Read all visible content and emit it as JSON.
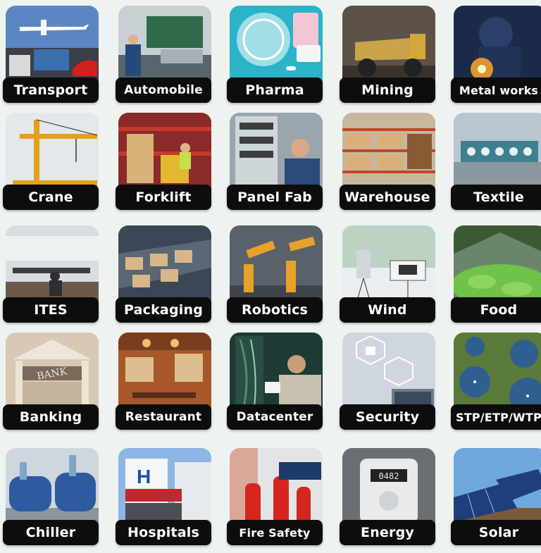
{
  "tiles": [
    {
      "label": "Transport",
      "icon": "airplane-truck-icon",
      "colors": [
        "#5b86c4",
        "#d9e4f2"
      ]
    },
    {
      "label": "Automobile",
      "icon": "car-assembly-icon",
      "colors": [
        "#6f7d86",
        "#c9d0d4"
      ]
    },
    {
      "label": "Pharma",
      "icon": "pills-icon",
      "colors": [
        "#2ab3c9",
        "#e8f6f8"
      ]
    },
    {
      "label": "Mining",
      "icon": "dump-truck-icon",
      "colors": [
        "#5c5248",
        "#c9a44a"
      ]
    },
    {
      "label": "Metal works",
      "icon": "welding-icon",
      "colors": [
        "#1c2a4a",
        "#f0a030"
      ]
    },
    {
      "label": "Crane",
      "icon": "crane-icon",
      "colors": [
        "#e4e8ea",
        "#e1a21a"
      ]
    },
    {
      "label": "Forklift",
      "icon": "forklift-icon",
      "colors": [
        "#8a2a2a",
        "#d9b27a"
      ]
    },
    {
      "label": "Panel Fab",
      "icon": "electric-panel-icon",
      "colors": [
        "#9aa6ae",
        "#2d4a78"
      ]
    },
    {
      "label": "Warehouse",
      "icon": "warehouse-racks-icon",
      "colors": [
        "#c7b79d",
        "#8a5a33"
      ]
    },
    {
      "label": "Textile",
      "icon": "textile-machine-icon",
      "colors": [
        "#b9c6cf",
        "#3f7f8f"
      ]
    },
    {
      "label": "ITES",
      "icon": "office-desk-icon",
      "colors": [
        "#d8dde0",
        "#3a3f45"
      ]
    },
    {
      "label": "Packaging",
      "icon": "conveyor-boxes-icon",
      "colors": [
        "#3b4754",
        "#d7b78a"
      ]
    },
    {
      "label": "Robotics",
      "icon": "robot-arm-icon",
      "colors": [
        "#59616b",
        "#e8a12a"
      ]
    },
    {
      "label": "Wind",
      "icon": "anemometer-icon",
      "colors": [
        "#9fc2a7",
        "#e9eef0"
      ]
    },
    {
      "label": "Food",
      "icon": "greenhouse-icon",
      "colors": [
        "#3b5a32",
        "#6fc24a"
      ]
    },
    {
      "label": "Banking",
      "icon": "bank-building-icon",
      "colors": [
        "#d8c9b4",
        "#7a6a5a"
      ]
    },
    {
      "label": "Restaurant",
      "icon": "restaurant-interior-icon",
      "colors": [
        "#a8572a",
        "#f0c06a"
      ]
    },
    {
      "label": "Datacenter",
      "icon": "server-cables-icon",
      "colors": [
        "#1e3a35",
        "#4a8f6a"
      ]
    },
    {
      "label": "Security",
      "icon": "lock-network-icon",
      "colors": [
        "#cfd6de",
        "#6a7c8e"
      ]
    },
    {
      "label": "STP/ETP/WTP",
      "icon": "water-treatment-icon",
      "colors": [
        "#5a7a3a",
        "#2f5f8f"
      ]
    },
    {
      "label": "Chiller",
      "icon": "chiller-plant-icon",
      "colors": [
        "#2e5aa0",
        "#7fa6c8"
      ]
    },
    {
      "label": "Hospitals",
      "icon": "hospital-sign-icon",
      "colors": [
        "#8db6e4",
        "#c0282e"
      ]
    },
    {
      "label": "Fire Safety",
      "icon": "fire-extinguisher-icon",
      "colors": [
        "#e2e4e6",
        "#d4261e"
      ]
    },
    {
      "label": "Energy",
      "icon": "energy-meter-icon",
      "colors": [
        "#6a6f73",
        "#e8eaec"
      ]
    },
    {
      "label": "Solar",
      "icon": "solar-panel-icon",
      "colors": [
        "#6fa8dc",
        "#1f3f7a"
      ]
    }
  ]
}
